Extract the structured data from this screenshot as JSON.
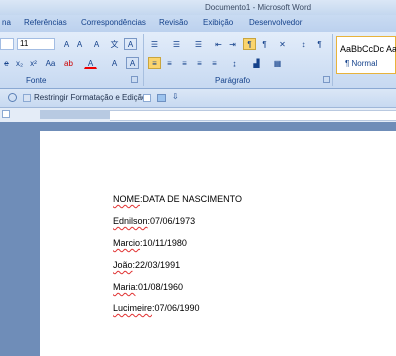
{
  "window": {
    "title": "Documento1 - Microsoft Word"
  },
  "tabs": [
    "na",
    "Referências",
    "Correspondências",
    "Revisão",
    "Exibição",
    "Desenvolvedor"
  ],
  "ribbon": {
    "font_size": "11",
    "groups": {
      "font": "Fonte",
      "paragraph": "Parágrafo"
    },
    "style_preview": "AaBbCcDc",
    "style_name": "¶ Normal",
    "style_preview_next": "Aa"
  },
  "toolbar": {
    "restrict_label": "Restringir Formatação e Edição"
  },
  "document": {
    "lines": [
      {
        "label": "NOME",
        "value": ":DATA DE NASCIMENTO"
      },
      {
        "label": "Ednilson",
        "value": ":07/06/1973"
      },
      {
        "label": "Marcio",
        "value": ":10/11/1980"
      },
      {
        "label": "João",
        "value": ":22/03/1991"
      },
      {
        "label": "Maria",
        "value": ":01/08/1960"
      },
      {
        "label": "Lucimeire",
        "value": ":07/06/1990"
      }
    ]
  },
  "icons": [
    "bold-icon",
    "italic-icon",
    "underline-icon",
    "bullets-icon",
    "numbering-icon",
    "align-left-icon",
    "center-icon",
    "align-right-icon",
    "justify-icon",
    "sort-icon",
    "pilcrow-icon",
    "highlight-icon",
    "font-color-icon"
  ],
  "colors": {
    "accent": "#fbd56e",
    "ribbon": "#c7d9f1",
    "workspace": "#6f8db8"
  }
}
